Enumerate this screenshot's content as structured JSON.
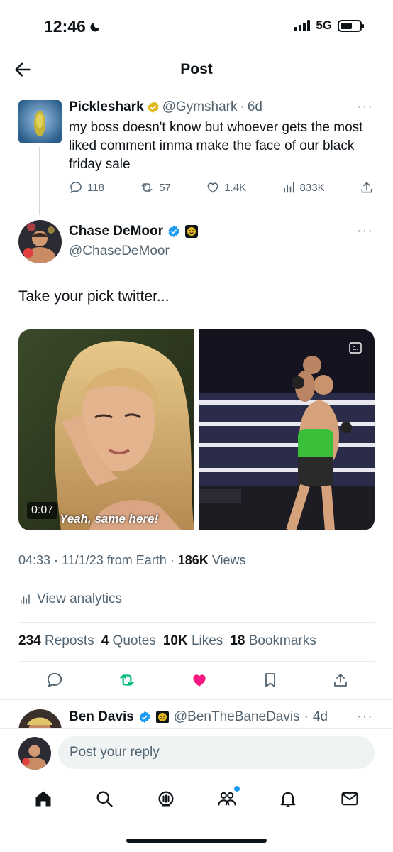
{
  "status": {
    "time": "12:46",
    "network": "5G"
  },
  "header": {
    "title": "Post"
  },
  "parent": {
    "name": "Pickleshark",
    "handle": "@Gymshark",
    "age": "6d",
    "text": "my boss doesn't know but whoever gets the most liked comment imma make the face of our black friday sale",
    "replies": "118",
    "reposts": "57",
    "likes": "1.4K",
    "views": "833K"
  },
  "post": {
    "name": "Chase DeMoor",
    "handle": "@ChaseDeMoor",
    "text": "Take your pick twitter...",
    "video_time": "0:07",
    "caption": "Yeah, same here!",
    "meta_time": "04:33 · 11/1/23 from Earth · ",
    "views_count": "186K",
    "views_label": " Views",
    "analytics": "View analytics",
    "stats": {
      "reposts_n": "234",
      "reposts_l": "Reposts",
      "quotes_n": "4",
      "quotes_l": "Quotes",
      "likes_n": "10K",
      "likes_l": "Likes",
      "bookmarks_n": "18",
      "bookmarks_l": "Bookmarks"
    }
  },
  "reply": {
    "name": "Ben Davis",
    "handle": "@BenTheBaneDavis",
    "age": "4d"
  },
  "composer": {
    "placeholder": "Post your reply"
  },
  "colors": {
    "accent": "#1d9bf0",
    "like": "#f91880",
    "repost": "#00ba7c",
    "gold": "#e2b719"
  }
}
